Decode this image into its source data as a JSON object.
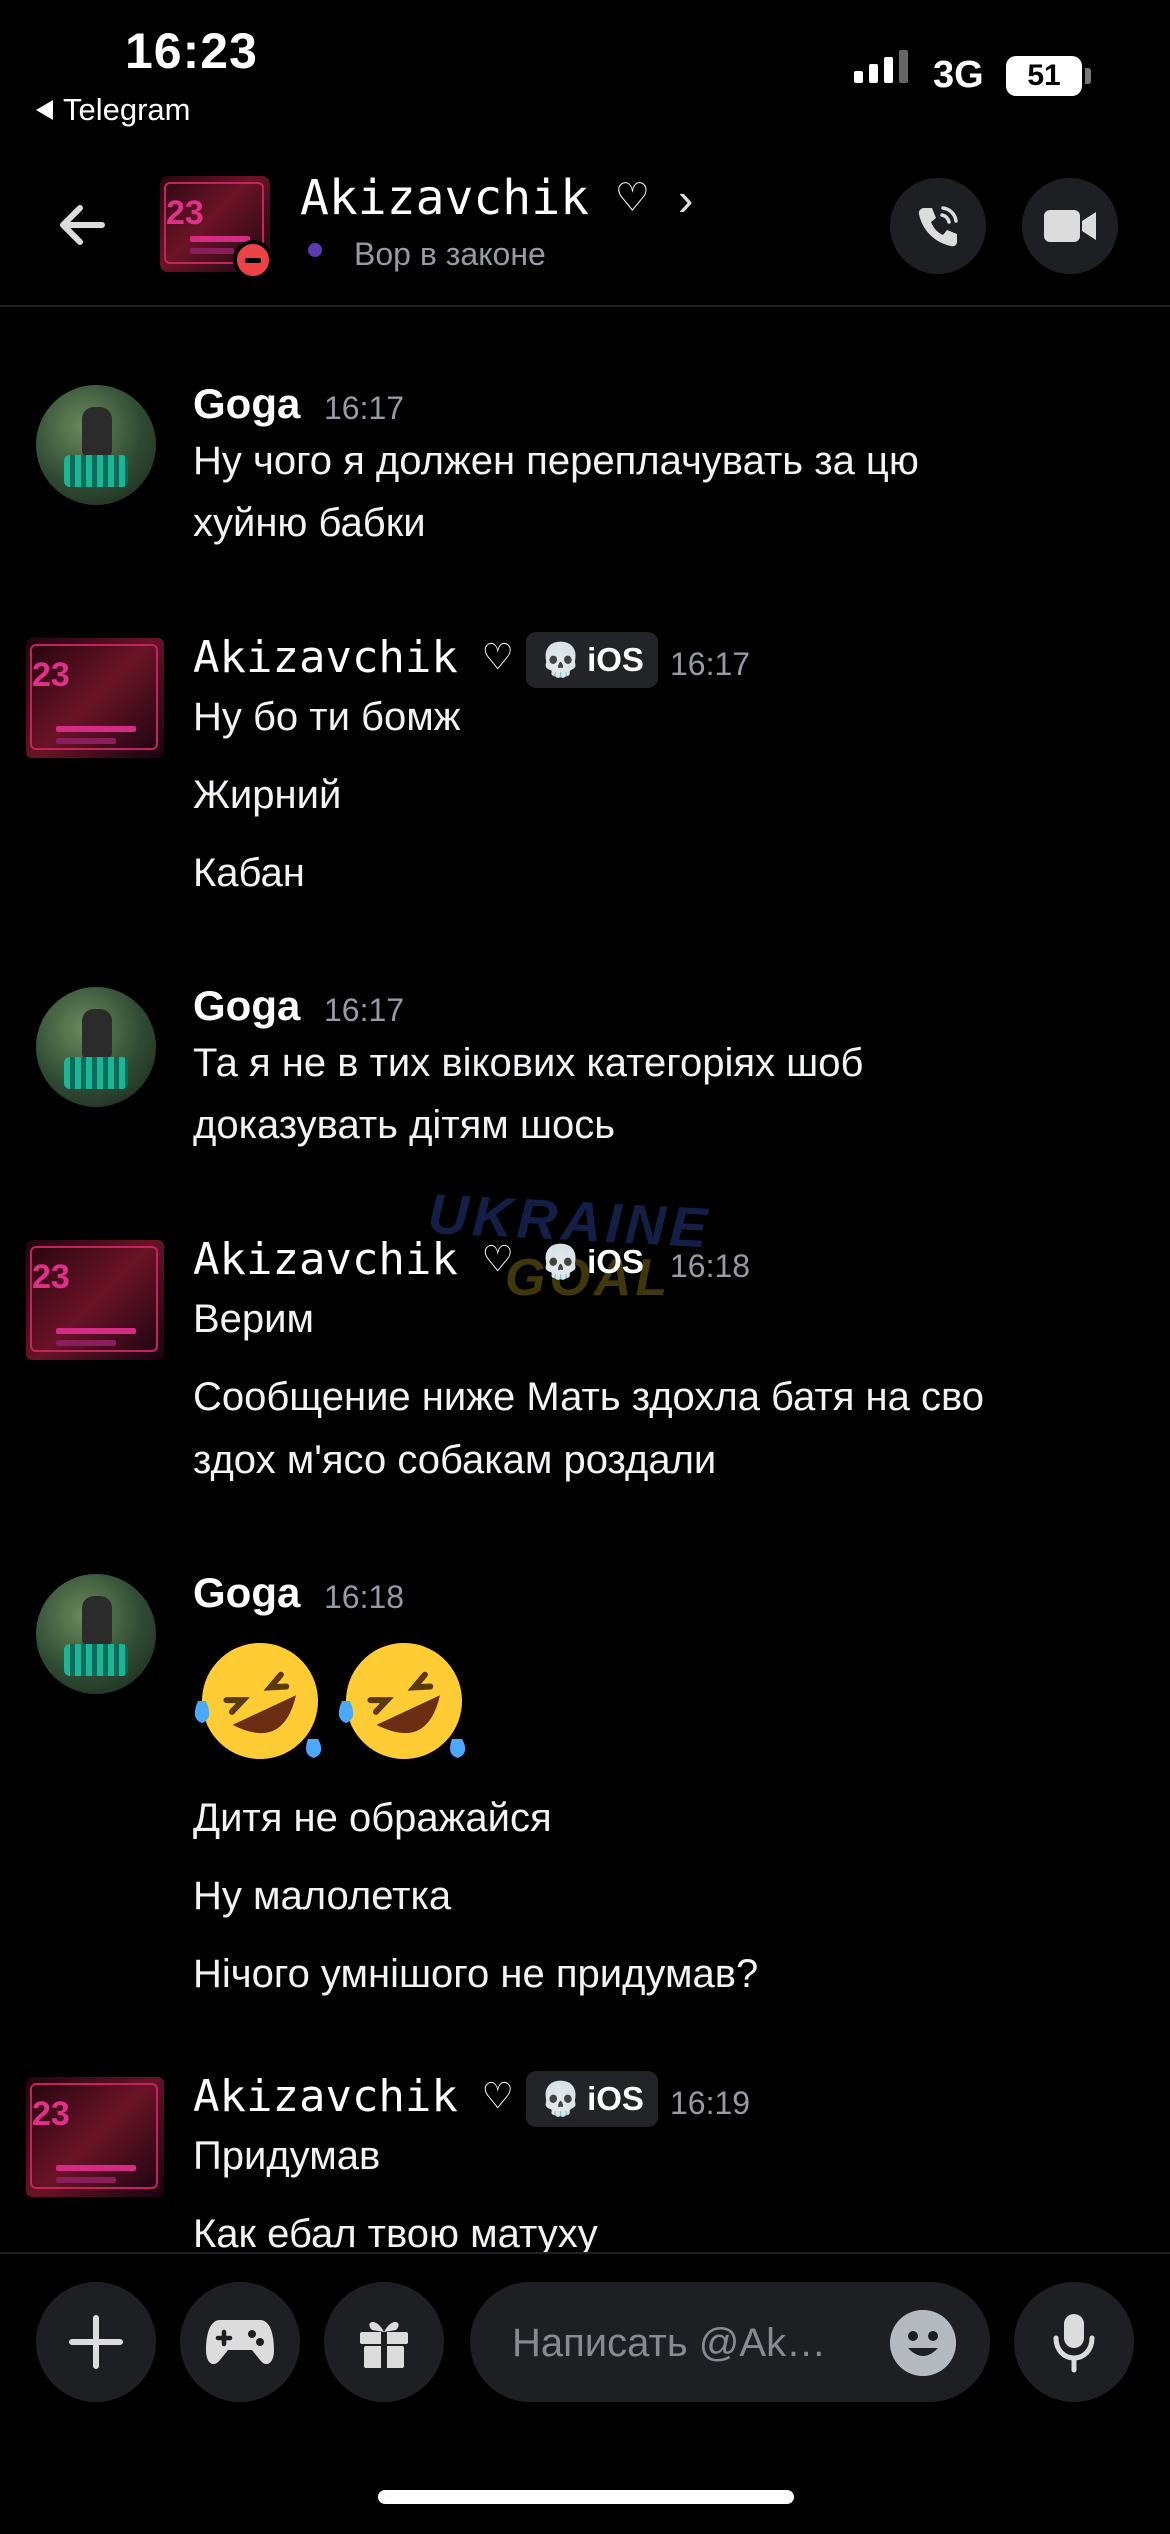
{
  "status_bar": {
    "time": "16:23",
    "back_app": "Telegram",
    "network": "3G",
    "battery": "51"
  },
  "header": {
    "title": "Akizavchik ♡",
    "chevron": "›",
    "subtitle": "Вор в законе",
    "icons": [
      "back-arrow-icon",
      "phone-call-icon",
      "video-camera-icon"
    ]
  },
  "messages": [
    {
      "author": "Goga",
      "time": "16:17",
      "lines": [
        "Ну чого я должен переплачувать за цю",
        "хуйню бабки"
      ]
    },
    {
      "author": "Akizavchik ♡",
      "tag": "iOS",
      "time": "16:17",
      "lines": [
        "Ну бо ти бомж",
        "Жирний",
        "Кабан"
      ]
    },
    {
      "author": "Goga",
      "time": "16:17",
      "lines": [
        "Та я не в тих вікових категоріях шоб",
        "доказувать дітям шось"
      ]
    },
    {
      "author": "Akizavchik ♡",
      "tag": "iOS",
      "time": "16:18",
      "lines": [
        "Верим",
        "Сообщение ниже Мать здохла батя на сво",
        "здох м'ясо собакам роздали"
      ]
    },
    {
      "author": "Goga",
      "time": "16:18",
      "lines": [
        "Дитя не ображайся",
        "Ну малолетка",
        "Нічого умнішого не придумав?"
      ]
    },
    {
      "author": "Akizavchik ♡",
      "tag": "iOS",
      "time": "16:19",
      "lines": [
        "Придумав",
        "Как ебал твою матуху"
      ]
    }
  ],
  "watermark": {
    "line1": "UKRAINE",
    "line2": "GOAL"
  },
  "composer": {
    "placeholder": "Написать @Ak…",
    "icons": [
      "plus-icon",
      "gamepad-icon",
      "gift-icon",
      "emoji-icon",
      "microphone-icon"
    ]
  },
  "colors": {
    "background": "#000000",
    "pill": "#1e1f22",
    "muted": "#949ba4",
    "dnd": "#ed4245"
  }
}
